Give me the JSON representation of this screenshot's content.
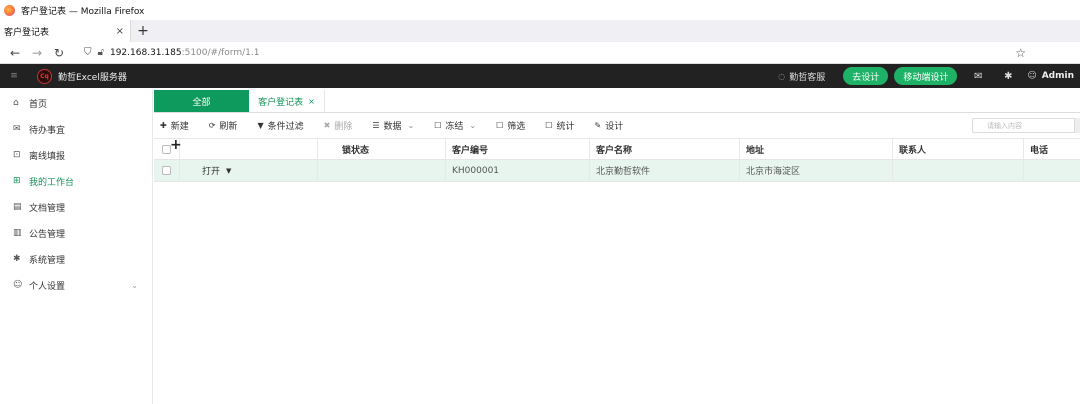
{
  "browser": {
    "window_title": "客户登记表 — Mozilla Firefox",
    "tab_label": "客户登记表",
    "tab_close": "×",
    "new_tab": "+",
    "url_host": "192.168.31.185",
    "url_path": ":5100/#/form/1.1"
  },
  "header": {
    "hamburger": "≡",
    "logo_text": "Cq",
    "app_name": "勤哲Excel服务器",
    "service_label": "勤哲客服",
    "design_button": "去设计",
    "mobile_design_button": "移动端设计",
    "user_name": "Admin"
  },
  "sidebar": {
    "items": [
      {
        "label": "首页",
        "icon": "home-icon"
      },
      {
        "label": "待办事宜",
        "icon": "mail-icon"
      },
      {
        "label": "离线填报",
        "icon": "offline-icon"
      },
      {
        "label": "我的工作台",
        "icon": "workbench-icon"
      },
      {
        "label": "文档管理",
        "icon": "doc-icon"
      },
      {
        "label": "公告管理",
        "icon": "notice-icon"
      },
      {
        "label": "系统管理",
        "icon": "gear-icon"
      },
      {
        "label": "个人设置",
        "icon": "user-icon"
      }
    ],
    "active_index": 3
  },
  "tabs": {
    "all": "全部",
    "form": "客户登记表",
    "form_close": "×"
  },
  "toolbar": {
    "new": "新建",
    "refresh": "刷新",
    "filter": "条件过滤",
    "delete": "删除",
    "data": "数据",
    "freeze": "冻结",
    "screen": "筛选",
    "stats": "统计",
    "design": "设计",
    "search_placeholder": "请输入内容"
  },
  "grid": {
    "columns": [
      "锁状态",
      "客户编号",
      "客户名称",
      "地址",
      "联系人",
      "电话"
    ],
    "rows": [
      {
        "action": "打开",
        "lock": "",
        "code": "KH000001",
        "name": "北京勤哲软件",
        "address": "北京市海淀区",
        "contact": "",
        "phone": ""
      }
    ]
  },
  "colors": {
    "accent": "#0e9a5c",
    "header_bg": "#222222",
    "row_highlight": "#e8f5ee"
  }
}
